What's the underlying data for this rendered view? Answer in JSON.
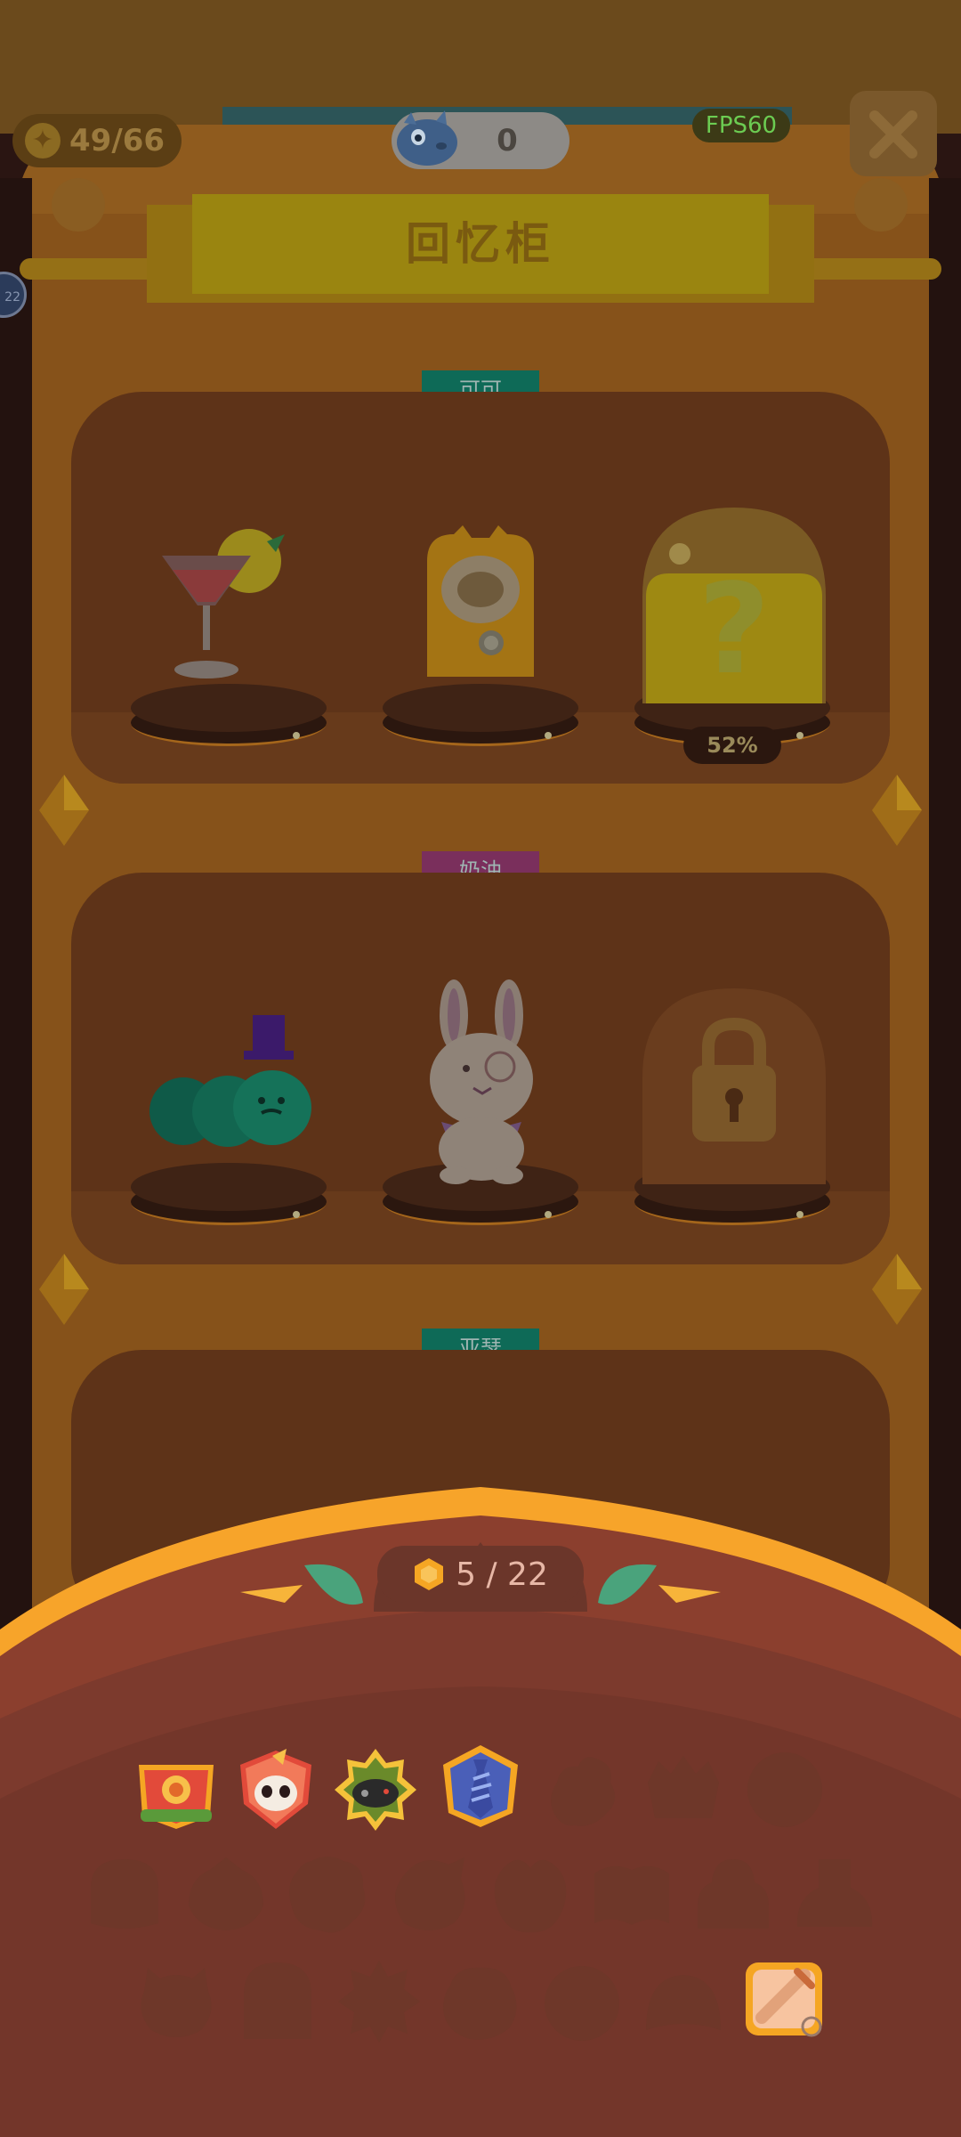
{
  "header": {
    "coins": "49/66",
    "mascot_count": "0",
    "fps": "FPS60",
    "side_badge": "22"
  },
  "title": "回忆柜",
  "shelves": [
    {
      "label": "可可",
      "label_color": "#0e6a57",
      "items": [
        "cocktail-glass",
        "owl-bag",
        "mystery-jar"
      ],
      "progress": "52%"
    },
    {
      "label": "奶油",
      "label_color": "#7a2f5c",
      "items": [
        "caterpillar-top-hat",
        "bunny-monocle",
        "locked-jar"
      ]
    },
    {
      "label": "亚瑟",
      "label_color": "#0e6a57",
      "items": []
    }
  ],
  "collection": {
    "counter": "5 / 22",
    "unlocked_count": 5,
    "total": 22,
    "slots": [
      "flower-badge",
      "panda-badge",
      "gamepad-badge",
      "tie-badge",
      "locked",
      "locked",
      "locked",
      "locked",
      "locked",
      "locked",
      "locked",
      "locked",
      "locked",
      "locked",
      "locked",
      "locked",
      "locked",
      "locked",
      "locked",
      "locked",
      "locked",
      "sword-card"
    ]
  },
  "colors": {
    "accent": "#f5a623",
    "drawer": "#7c3a2d",
    "teal_label": "#0e6a57",
    "pink_label": "#7a2f5c"
  }
}
